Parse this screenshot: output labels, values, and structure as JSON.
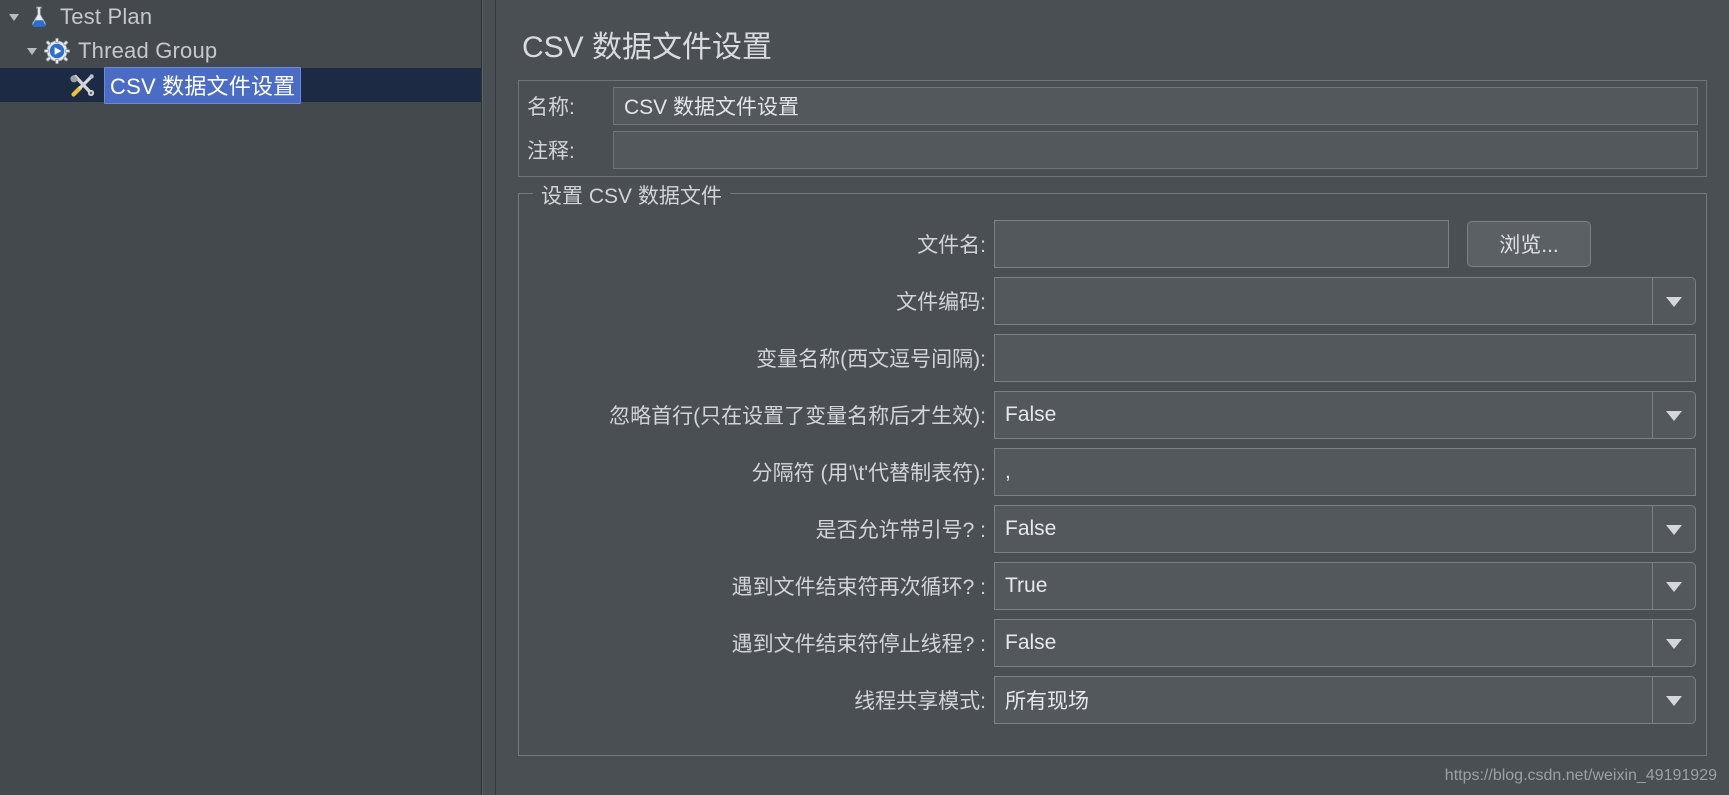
{
  "colors": {
    "window_bg": "#4a4f53",
    "tree_bg": "#44494d",
    "selection_row_bg": "#1d2a44",
    "selection_text_bg": "#4a6cc4",
    "field_bg": "#53585c",
    "border": "#7b8186",
    "text": "#d2d5d7"
  },
  "tree": {
    "items": [
      {
        "label": "Test Plan",
        "icon": "flask-icon",
        "depth": 0,
        "expanded": true,
        "selected": false
      },
      {
        "label": "Thread Group",
        "icon": "gear-play-icon",
        "depth": 1,
        "expanded": true,
        "selected": false
      },
      {
        "label": "CSV 数据文件设置",
        "icon": "tools-icon",
        "depth": 2,
        "expanded": null,
        "selected": true
      }
    ]
  },
  "panel": {
    "title": "CSV 数据文件设置",
    "meta": {
      "name_label": "名称:",
      "name_value": "CSV 数据文件设置",
      "comment_label": "注释:",
      "comment_value": ""
    },
    "group": {
      "legend": "设置 CSV 数据文件",
      "rows": [
        {
          "label": "文件名:",
          "type": "text-with-button",
          "value": "",
          "button_label": "浏览...",
          "name": "filename"
        },
        {
          "label": "文件编码:",
          "type": "combo",
          "value": "",
          "name": "file-encoding"
        },
        {
          "label": "变量名称(西文逗号间隔):",
          "type": "text",
          "value": "",
          "name": "variable-names"
        },
        {
          "label": "忽略首行(只在设置了变量名称后才生效):",
          "type": "combo",
          "value": "False",
          "name": "ignore-first-line"
        },
        {
          "label": "分隔符 (用'\\t'代替制表符):",
          "type": "text",
          "value": ",",
          "name": "delimiter"
        },
        {
          "label": "是否允许带引号? :",
          "type": "combo",
          "value": "False",
          "name": "allow-quoted-data"
        },
        {
          "label": "遇到文件结束符再次循环? :",
          "type": "combo",
          "value": "True",
          "name": "recycle-on-eof"
        },
        {
          "label": "遇到文件结束符停止线程? :",
          "type": "combo",
          "value": "False",
          "name": "stop-thread-on-eof"
        },
        {
          "label": "线程共享模式:",
          "type": "combo",
          "value": "所有现场",
          "name": "sharing-mode"
        }
      ]
    }
  },
  "watermark": "https://blog.csdn.net/weixin_49191929"
}
